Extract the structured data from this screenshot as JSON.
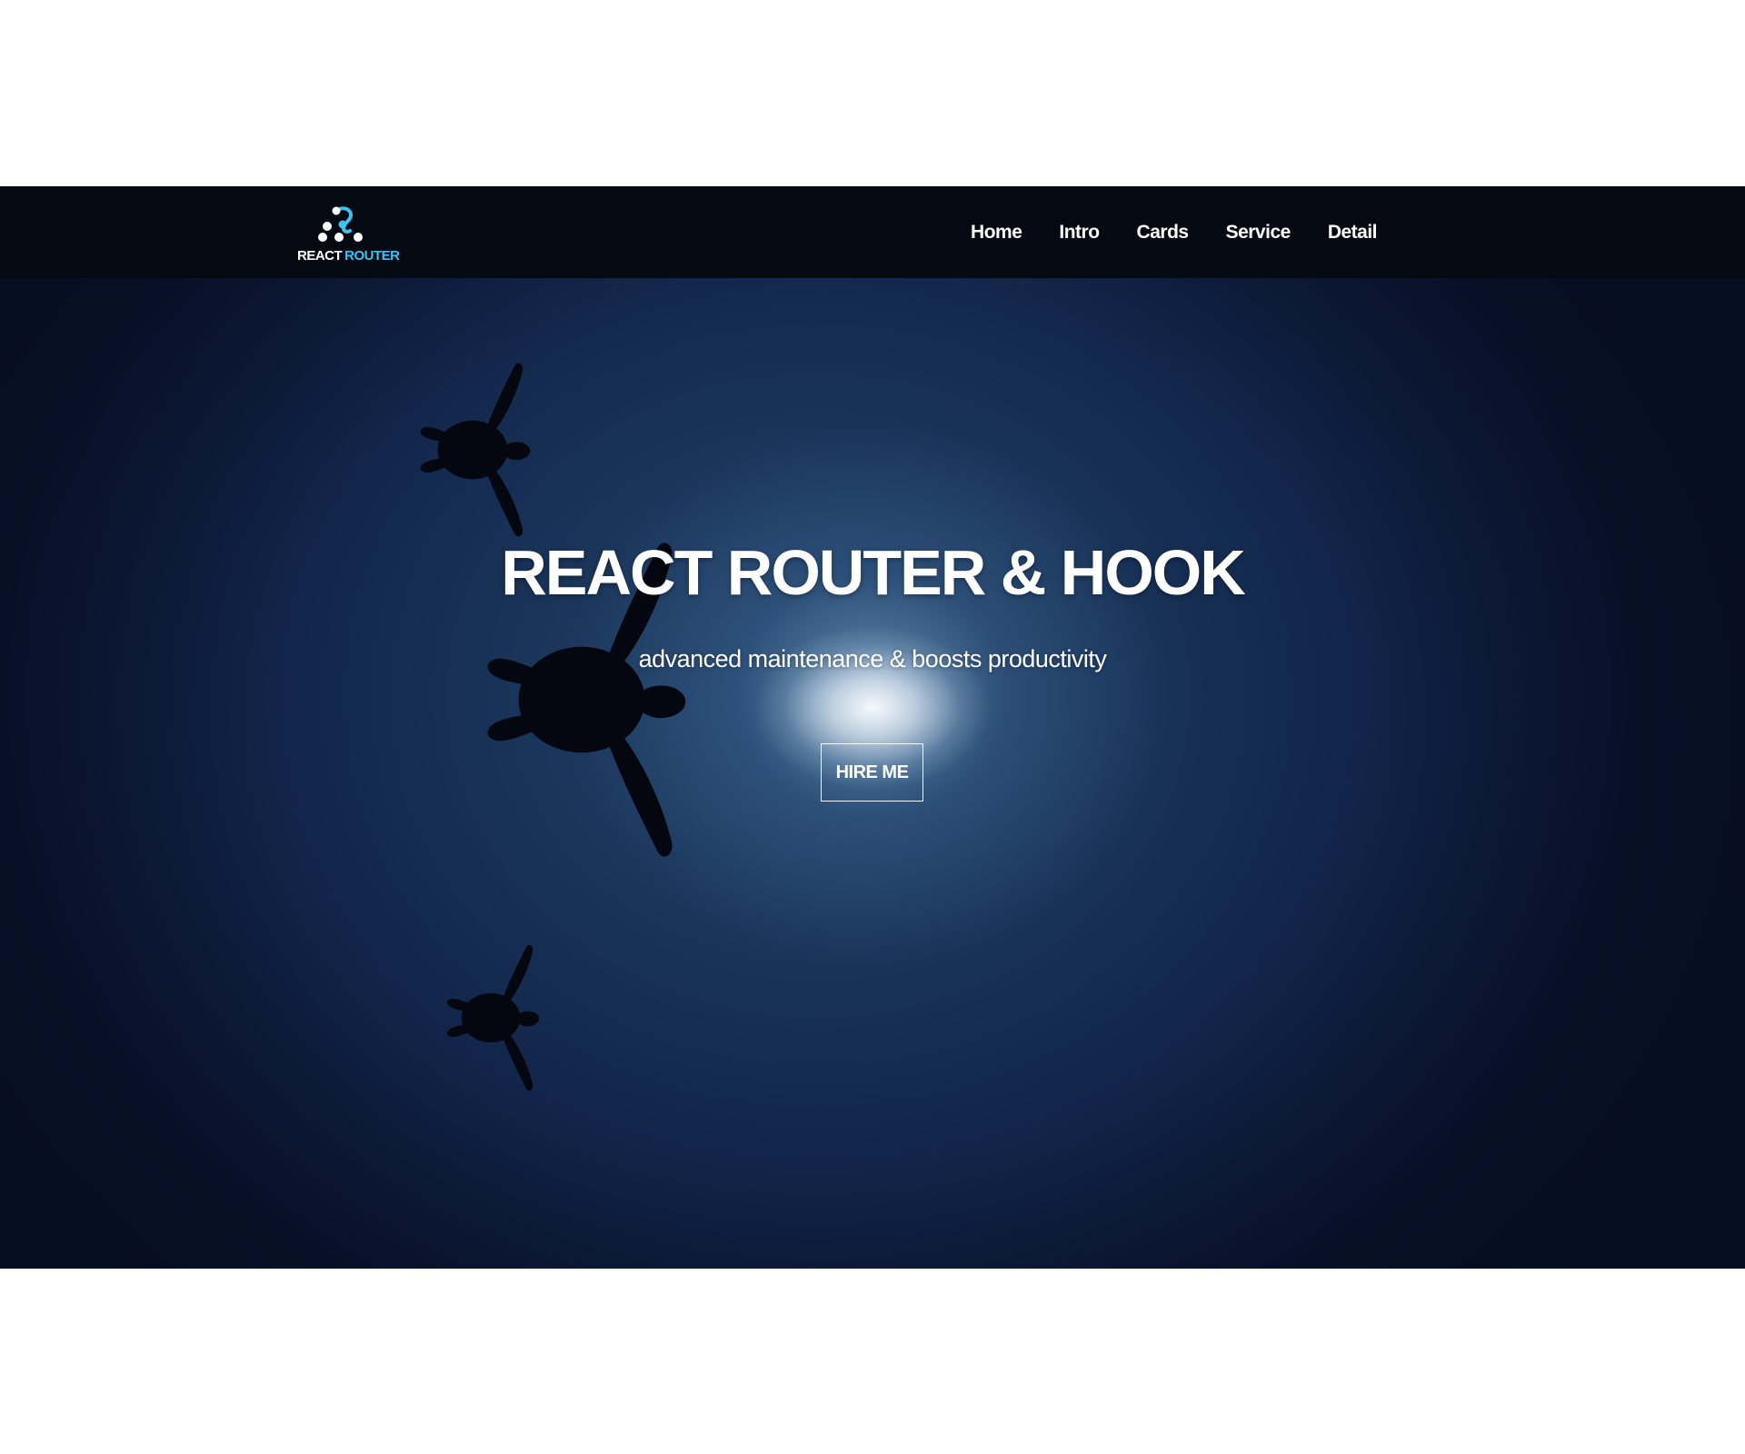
{
  "brand": {
    "logo_word_1": "REACT",
    "logo_word_2": "ROUTER",
    "logo_icon": "react-router-logo-icon",
    "accent_color": "#3fc1f0"
  },
  "nav": {
    "items": [
      {
        "label": "Home"
      },
      {
        "label": "Intro"
      },
      {
        "label": "Cards"
      },
      {
        "label": "Service"
      },
      {
        "label": "Detail"
      }
    ]
  },
  "hero": {
    "title": "REACT ROUTER & HOOK",
    "subtitle": "advanced maintenance & boosts productivity",
    "cta_label": "HIRE ME",
    "background_image": "underwater-sea-turtles-silhouette-image"
  },
  "colors": {
    "navbar_bg": "#050a12",
    "hero_deep_blue": "#12254a",
    "text": "#ffffff"
  }
}
